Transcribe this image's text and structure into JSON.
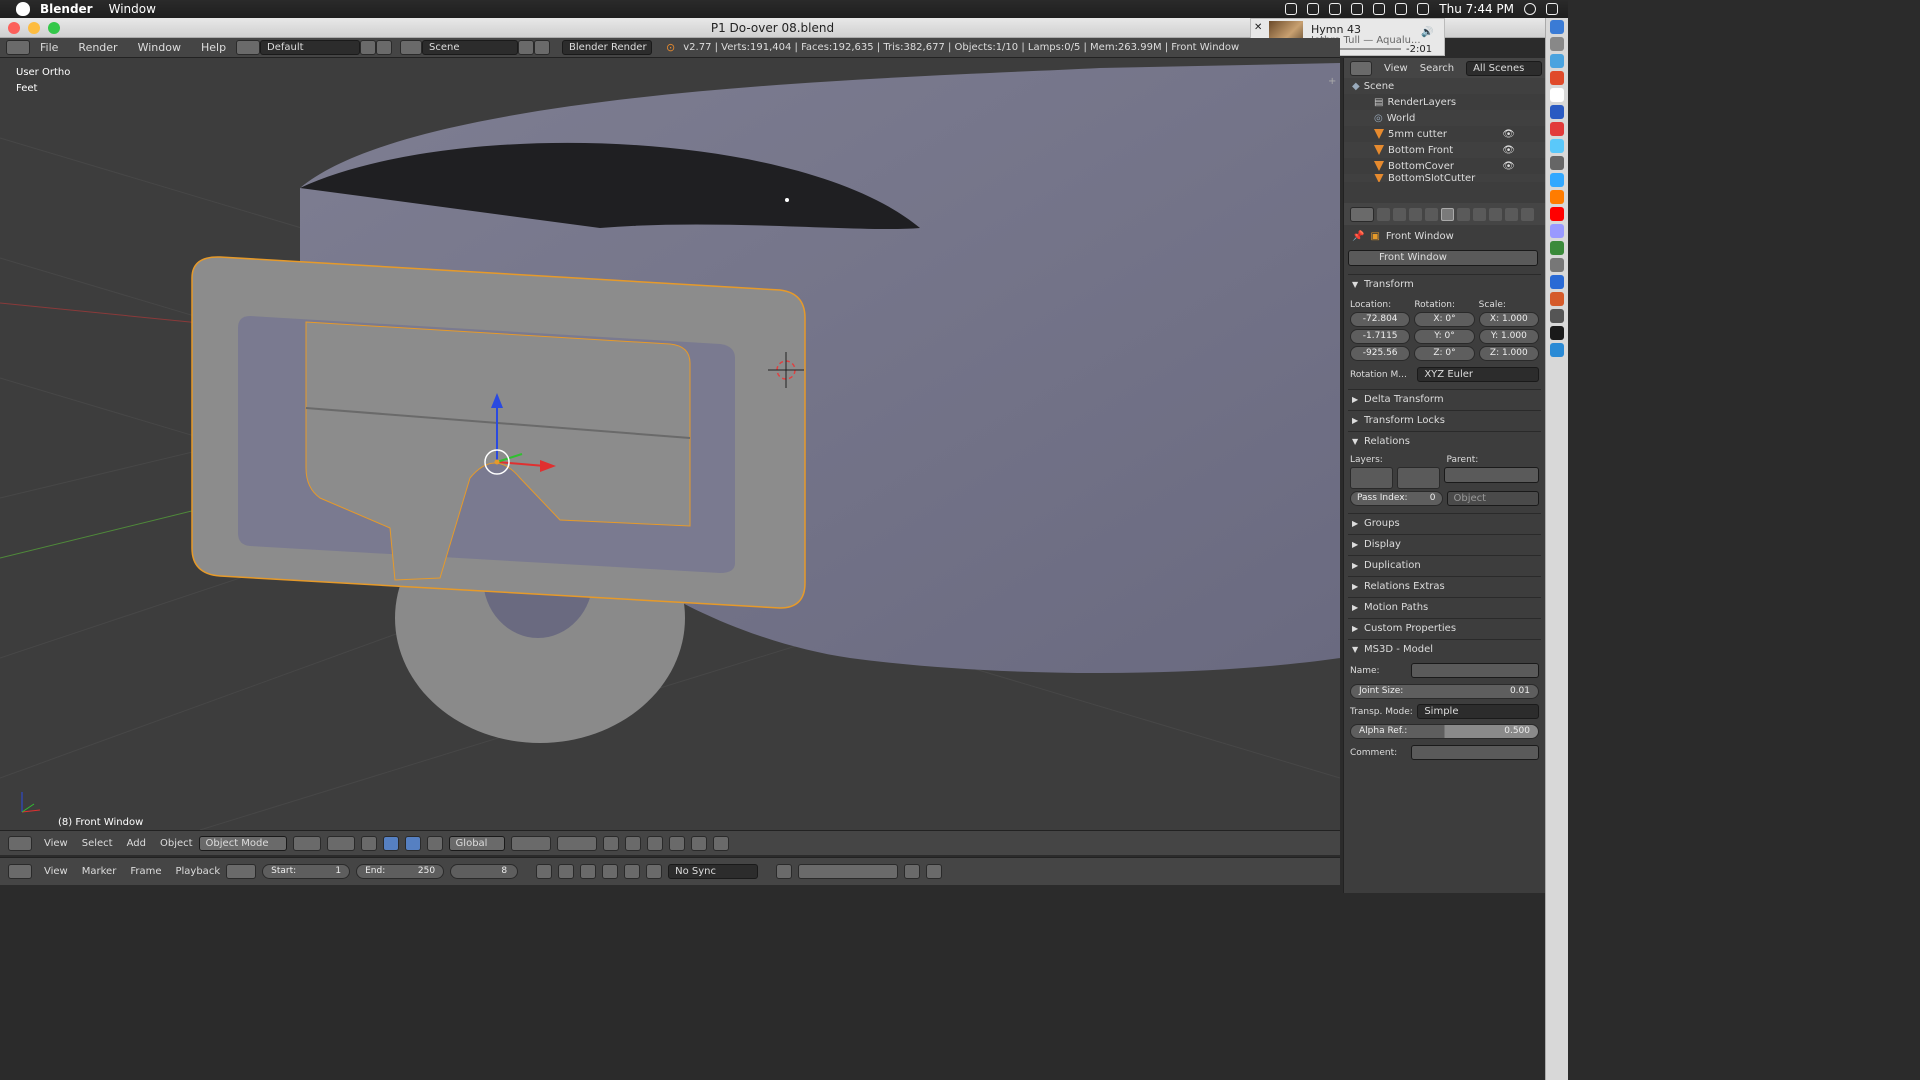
{
  "mac_menu": {
    "app": "Blender",
    "items": [
      "Window"
    ],
    "clock": "Thu 7:44 PM"
  },
  "window": {
    "title": "P1 Do-over 08.blend"
  },
  "music": {
    "track": "Hymn 43",
    "artist": "Jethro Tull — Aqualu...",
    "remaining": "-2:01"
  },
  "header": {
    "menus": [
      "File",
      "Render",
      "Window",
      "Help"
    ],
    "layout": "Default",
    "scene": "Scene",
    "engine": "Blender Render",
    "stats": "v2.77 | Verts:191,404 | Faces:192,635 | Tris:382,677 | Objects:1/10 | Lamps:0/5 | Mem:263.99M | Front Window"
  },
  "viewport": {
    "view_label": "User Ortho",
    "units_label": "Feet",
    "object_label": "(8) Front Window"
  },
  "viewport_bar": {
    "menus": [
      "View",
      "Select",
      "Add",
      "Object"
    ],
    "mode": "Object Mode",
    "orientation": "Global"
  },
  "timeline": {
    "menus": [
      "View",
      "Marker",
      "Frame",
      "Playback"
    ],
    "start_label": "Start:",
    "start": "1",
    "end_label": "End:",
    "end": "250",
    "current": "8",
    "sync": "No Sync"
  },
  "outliner": {
    "menus": [
      "View",
      "Search"
    ],
    "filter": "All Scenes",
    "items": [
      {
        "label": "Scene",
        "type": "scene"
      },
      {
        "label": "RenderLayers",
        "type": "layers"
      },
      {
        "label": "World",
        "type": "world"
      },
      {
        "label": "5mm cutter",
        "type": "object"
      },
      {
        "label": "Bottom Front",
        "type": "object"
      },
      {
        "label": "BottomCover",
        "type": "object"
      },
      {
        "label": "BottomSlotCutter",
        "type": "object"
      }
    ]
  },
  "properties": {
    "breadcrumb": "Front Window",
    "object_name": "Front Window",
    "transform_label": "Transform",
    "location_label": "Location:",
    "rotation_label": "Rotation:",
    "scale_label": "Scale:",
    "location": [
      "-72.804",
      "-1.7115",
      "-925.56"
    ],
    "rotation": [
      "X:",
      "0°",
      "Y:",
      "0°",
      "Z:",
      "0°"
    ],
    "scale": [
      "X: 1.000",
      "Y: 1.000",
      "Z: 1.000"
    ],
    "rotation_mode_label": "Rotation M...",
    "rotation_mode": "XYZ Euler",
    "panels_collapsed": [
      "Delta Transform",
      "Transform Locks"
    ],
    "relations_label": "Relations",
    "layers_label": "Layers:",
    "parent_label": "Parent:",
    "parent_type": "Object",
    "pass_index_label": "Pass Index:",
    "pass_index": "0",
    "more_panels": [
      "Groups",
      "Display",
      "Duplication",
      "Relations Extras",
      "Motion Paths",
      "Custom Properties"
    ],
    "ms3d_label": "MS3D - Model",
    "name_label": "Name:",
    "joint_size_label": "Joint Size:",
    "joint_size": "0.01",
    "transp_label": "Transp. Mode:",
    "transp_mode": "Simple",
    "alpha_label": "Alpha Ref.:",
    "alpha_ref": "0.500",
    "alpha_fill": 0.5,
    "comment_label": "Comment:"
  },
  "colors": {
    "selection_outline": "#e69a2a",
    "accent": "#5680c2"
  }
}
